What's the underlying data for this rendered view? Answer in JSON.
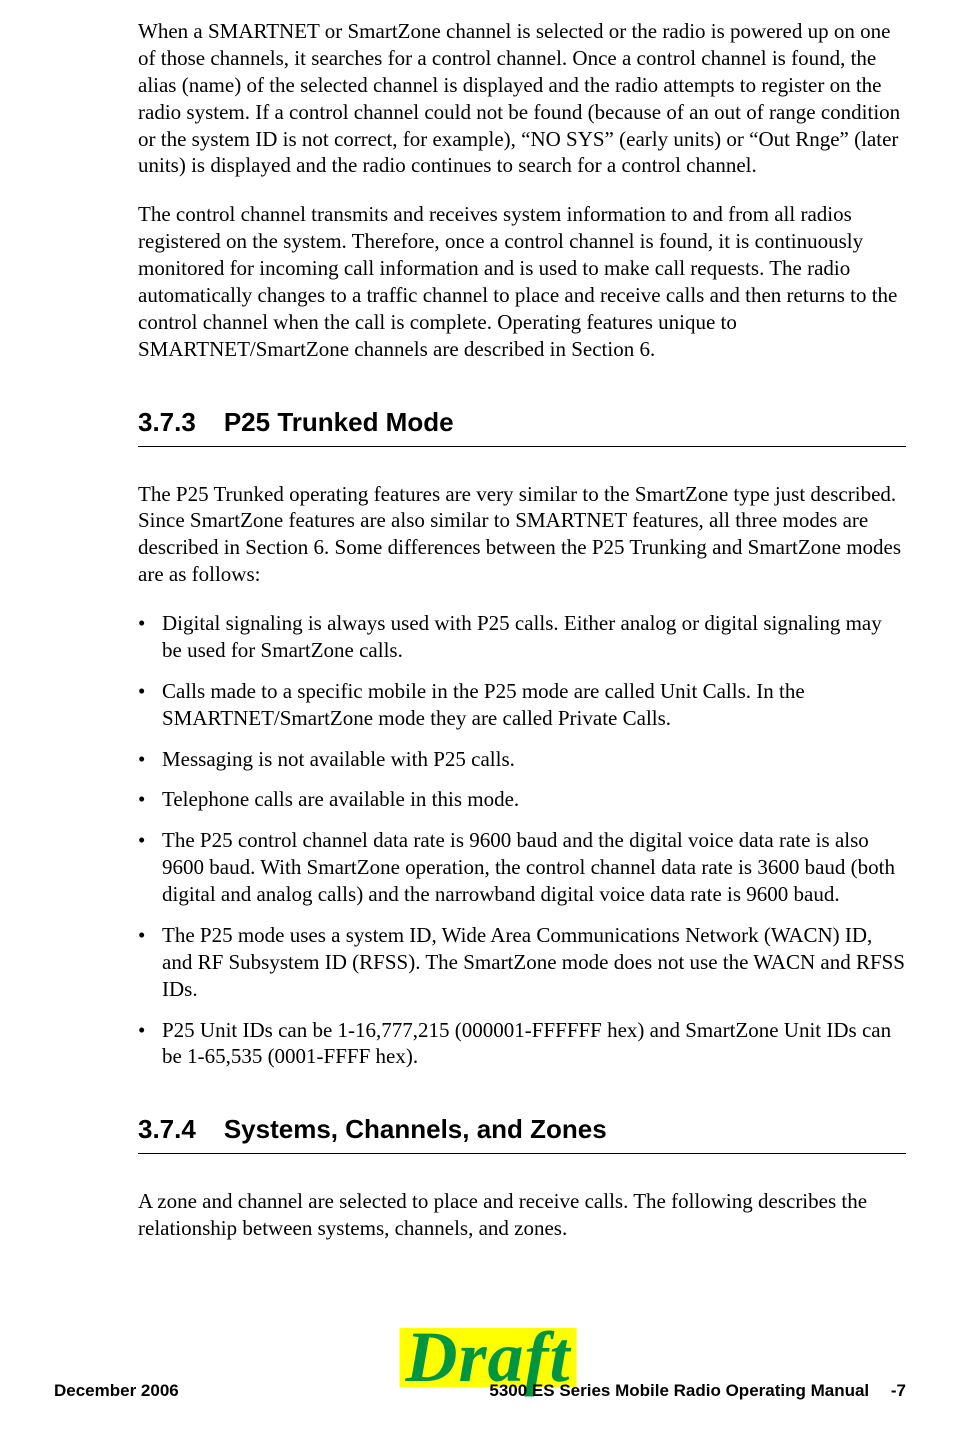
{
  "para1": "When a SMARTNET or SmartZone channel is selected or the radio is powered up on one of those channels, it searches for a control channel. Once a control channel is found, the alias (name) of the selected channel is displayed and the radio attempts to register on the radio system. If a control channel could not be found (because of an out of range condition or the system ID is not correct, for example), “NO SYS” (early units) or “Out Rnge” (later units) is displayed and the radio continues to search for a control channel.",
  "para2": "The control channel transmits and receives system information to and from all radios registered on the system. Therefore, once a control channel is found, it is continuously monitored for incoming call information and is used to make call requests. The radio automatically changes to a traffic channel to place and receive calls and then returns to the control channel when the call is complete. Operating features unique to SMARTNET/SmartZone channels are described in Section 6.",
  "sec373": {
    "num": "3.7.3",
    "title": "P25 Trunked Mode"
  },
  "para3": "The P25 Trunked operating features are very similar to the SmartZone type just described. Since SmartZone features are also similar to SMARTNET features, all three modes are described in Section 6. Some differences between the P25 Trunking and SmartZone modes are as follows:",
  "bullets373": [
    "Digital signaling is always used with P25 calls. Either analog or digital signaling may be used for SmartZone calls.",
    "Calls made to a specific mobile in the P25 mode are called Unit Calls. In the SMARTNET/SmartZone mode they are called Private Calls.",
    "Messaging is not available with P25 calls.",
    "Telephone calls are available in this mode.",
    "The P25 control channel data rate is 9600 baud and the digital voice data rate is also 9600 baud. With SmartZone operation, the control channel data rate is 3600 baud (both digital and analog calls) and the narrowband digital voice data rate is 9600 baud.",
    "The P25 mode uses a system ID, Wide Area Communications Network (WACN) ID, and RF Subsystem ID (RFSS). The SmartZone mode does not use the WACN and RFSS IDs.",
    "P25 Unit IDs can be 1-16,777,215 (000001-FFFFFF hex) and SmartZone Unit IDs can be 1-65,535 (0001-FFFF hex)."
  ],
  "sec374": {
    "num": "3.7.4",
    "title": "Systems, Channels, and Zones"
  },
  "para4": "A zone and channel are selected to place and receive calls. The following describes the relationship between systems, channels, and zones.",
  "footer": {
    "left": "December 2006",
    "right": "5300 ES Series Mobile Radio Operating Manual  -7",
    "watermark": "Draft"
  }
}
